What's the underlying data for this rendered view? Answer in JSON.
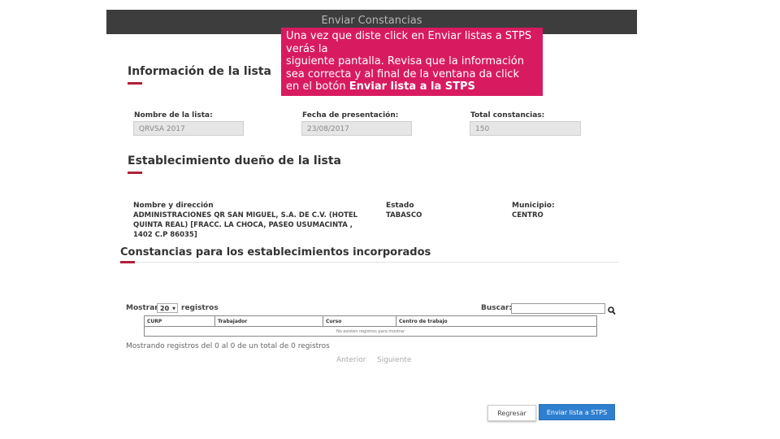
{
  "window": {
    "title": "Enviar Constancias"
  },
  "callout": {
    "text": "Una vez que diste click en Enviar listas a STPS\nverás la\nsiguiente pantalla. Revisa que la información\nsea correcta y al final de la ventana da click\nen el botón ",
    "bold": "Enviar lista a la STPS"
  },
  "info_lista": {
    "title": "Información de la lista",
    "fields": [
      {
        "label": "Nombre de la lista:",
        "value": "QRVSA 2017"
      },
      {
        "label": "Fecha de presentación:",
        "value": "23/08/2017"
      },
      {
        "label": "Total constancias:",
        "value": "150"
      }
    ]
  },
  "establecimiento": {
    "title": "Establecimiento dueño de la lista",
    "nombre_label": "Nombre y dirección",
    "nombre_value": "ADMINISTRACIONES QR SAN MIGUEL, S.A. DE C.V. (HOTEL QUINTA REAL) [FRACC. LA CHOCA, PASEO USUMACINTA , 1402 C.P 86035]",
    "estado_label": "Estado",
    "estado_value": "TABASCO",
    "municipio_label": "Municipio:",
    "municipio_value": "CENTRO"
  },
  "constancias": {
    "title": "Constancias para los establecimientos incorporados",
    "show_label": "Mostrar",
    "page_size": "20",
    "records_label": "registros",
    "search_label": "Buscar:",
    "search_value": "",
    "columns": [
      "CURP",
      "Trabajador",
      "Curso",
      "Centro de trabajo"
    ],
    "empty_message": "No existen registros para mostrar",
    "summary": "Mostrando registros del 0 al 0 de un total de 0 registros",
    "prev_label": "Anterior",
    "next_label": "Siguiente"
  },
  "buttons": {
    "back": "Regresar",
    "send": "Enviar lista a STPS"
  }
}
